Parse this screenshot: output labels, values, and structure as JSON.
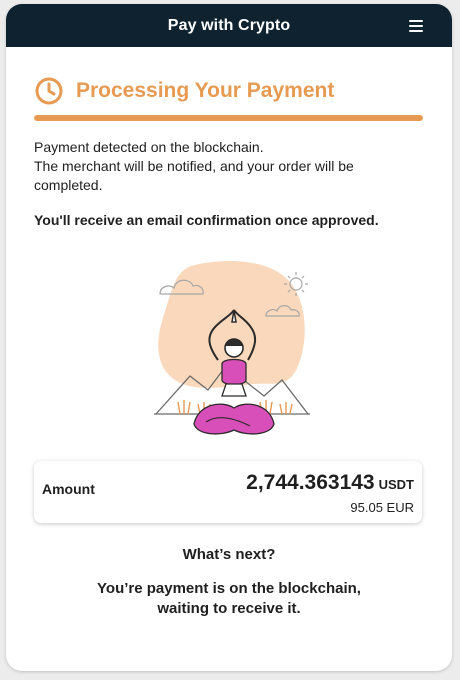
{
  "header": {
    "title": "Pay with Crypto",
    "menu_icon": "hamburger-menu-icon"
  },
  "status": {
    "icon": "clock-icon",
    "title": "Processing Your Payment",
    "progress_percent": 100,
    "accent_color": "#e69a52"
  },
  "message": {
    "line1": "Payment detected on the blockchain.",
    "line2": "The merchant will be notified, and your order will be completed.",
    "emphasis": "You'll receive an email confirmation once approved."
  },
  "illustration": {
    "icon": "meditating-woman-illustration"
  },
  "amount": {
    "label": "Amount",
    "value": "2,744.363143",
    "currency": "USDT",
    "fiat": "95.05 EUR"
  },
  "next": {
    "title": "What’s next?",
    "line1": "You’re payment is on the blockchain,",
    "line2": "waiting to receive it."
  },
  "colors": {
    "header_bg": "#0e2230",
    "accent": "#e69a52",
    "illustration_pink": "#d94fb9"
  }
}
